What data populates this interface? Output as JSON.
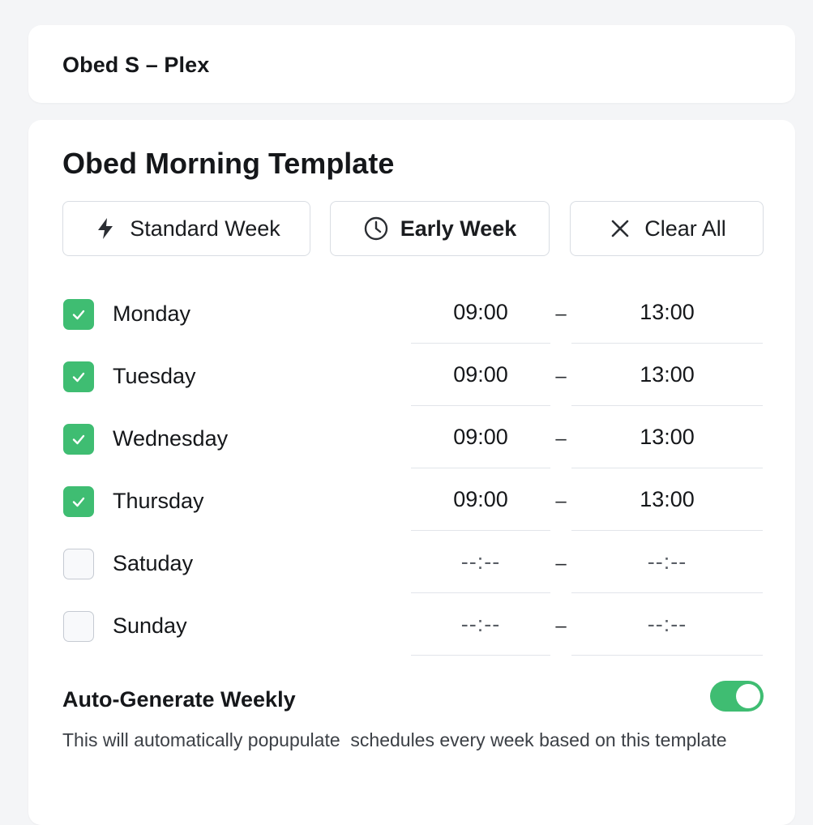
{
  "header": {
    "title": "Obed S – Plex"
  },
  "template": {
    "title": "Obed Morning Template",
    "buttons": [
      {
        "label": "Standard Week",
        "icon": "lightning-icon"
      },
      {
        "label": "Early Week",
        "icon": "clock-icon"
      },
      {
        "label": "Clear All",
        "icon": "close-icon"
      }
    ],
    "days": [
      {
        "label": "Monday",
        "checked": true,
        "start": "09:00",
        "end": "13:00"
      },
      {
        "label": "Tuesday",
        "checked": true,
        "start": "09:00",
        "end": "13:00"
      },
      {
        "label": "Wednesday",
        "checked": true,
        "start": "09:00",
        "end": "13:00"
      },
      {
        "label": "Thursday",
        "checked": true,
        "start": "09:00",
        "end": "13:00"
      },
      {
        "label": "Satuday",
        "checked": false,
        "start": "--:--",
        "end": "--:--"
      },
      {
        "label": "Sunday",
        "checked": false,
        "start": "--:--",
        "end": "--:--"
      }
    ],
    "separator": "–"
  },
  "auto_generate": {
    "title": "Auto-Generate Weekly",
    "enabled": true,
    "description": "This will automatically popupulate  schedules every week based on this template"
  },
  "colors": {
    "accent": "#3fbd72",
    "background": "#f4f5f7",
    "card": "#ffffff",
    "border": "#d9dde3"
  }
}
